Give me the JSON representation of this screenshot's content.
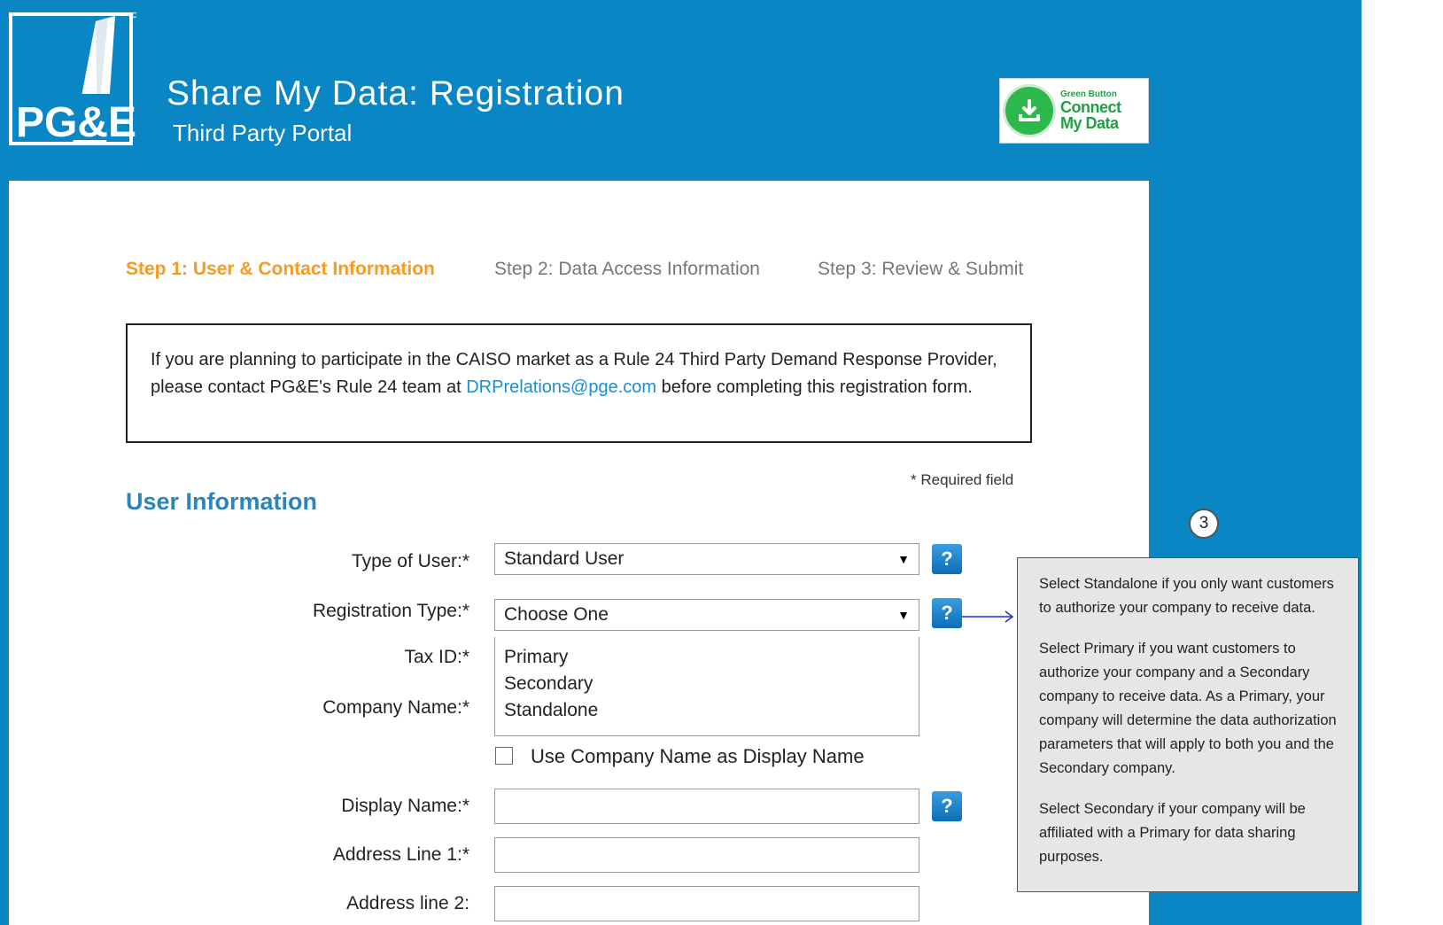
{
  "header": {
    "logo_text": "PG&E",
    "title": "Share My Data: Registration",
    "subtitle": "Third Party Portal",
    "badge": {
      "line1": "Green Button",
      "line2": "Connect",
      "line3": "My Data"
    }
  },
  "steps": [
    {
      "label": "Step 1: User & Contact Information",
      "active": true
    },
    {
      "label": "Step 2: Data Access Information",
      "active": false
    },
    {
      "label": "Step 3: Review & Submit",
      "active": false
    }
  ],
  "notice": {
    "text_before": "If you are planning to participate in the CAISO market as a Rule 24 Third Party Demand Response Provider, please contact PG&E's Rule 24 team at ",
    "link": "DRPrelations@pge.com",
    "text_after": " before completing this registration form."
  },
  "required_note": "* Required field",
  "section_title": "User Information",
  "form": {
    "type_of_user": {
      "label": "Type of User:*",
      "value": "Standard User"
    },
    "registration_type": {
      "label": "Registration Type:*",
      "value": "Choose One",
      "options": [
        "Primary",
        "Secondary",
        "Standalone"
      ]
    },
    "tax_id": {
      "label": "Tax ID:*"
    },
    "company_name": {
      "label": "Company Name:*"
    },
    "use_company_name": {
      "label": "Use Company Name as Display Name",
      "checked": false
    },
    "display_name": {
      "label": "Display Name:*",
      "value": ""
    },
    "address1": {
      "label": "Address Line 1:*",
      "value": ""
    },
    "address2": {
      "label": "Address line 2:",
      "value": ""
    }
  },
  "help_glyph": "?",
  "callout": {
    "number": "3",
    "paragraphs": [
      "Select Standalone if you only want customers to authorize your company to receive data.",
      "Select Primary if you want customers to authorize your company and a Secondary company  to receive data. As a Primary, your company will determine the data authorization parameters that will apply to both you and the Secondary company.",
      "Select Secondary if your company will be affiliated with a Primary for data sharing purposes."
    ]
  },
  "colors": {
    "brand": "#0a86c4",
    "step_active": "#f59a23",
    "link": "#1a8fd0",
    "section": "#2a85b8"
  },
  "icons": {
    "select_arrow": "▼",
    "badge_icon": "download-icon"
  }
}
